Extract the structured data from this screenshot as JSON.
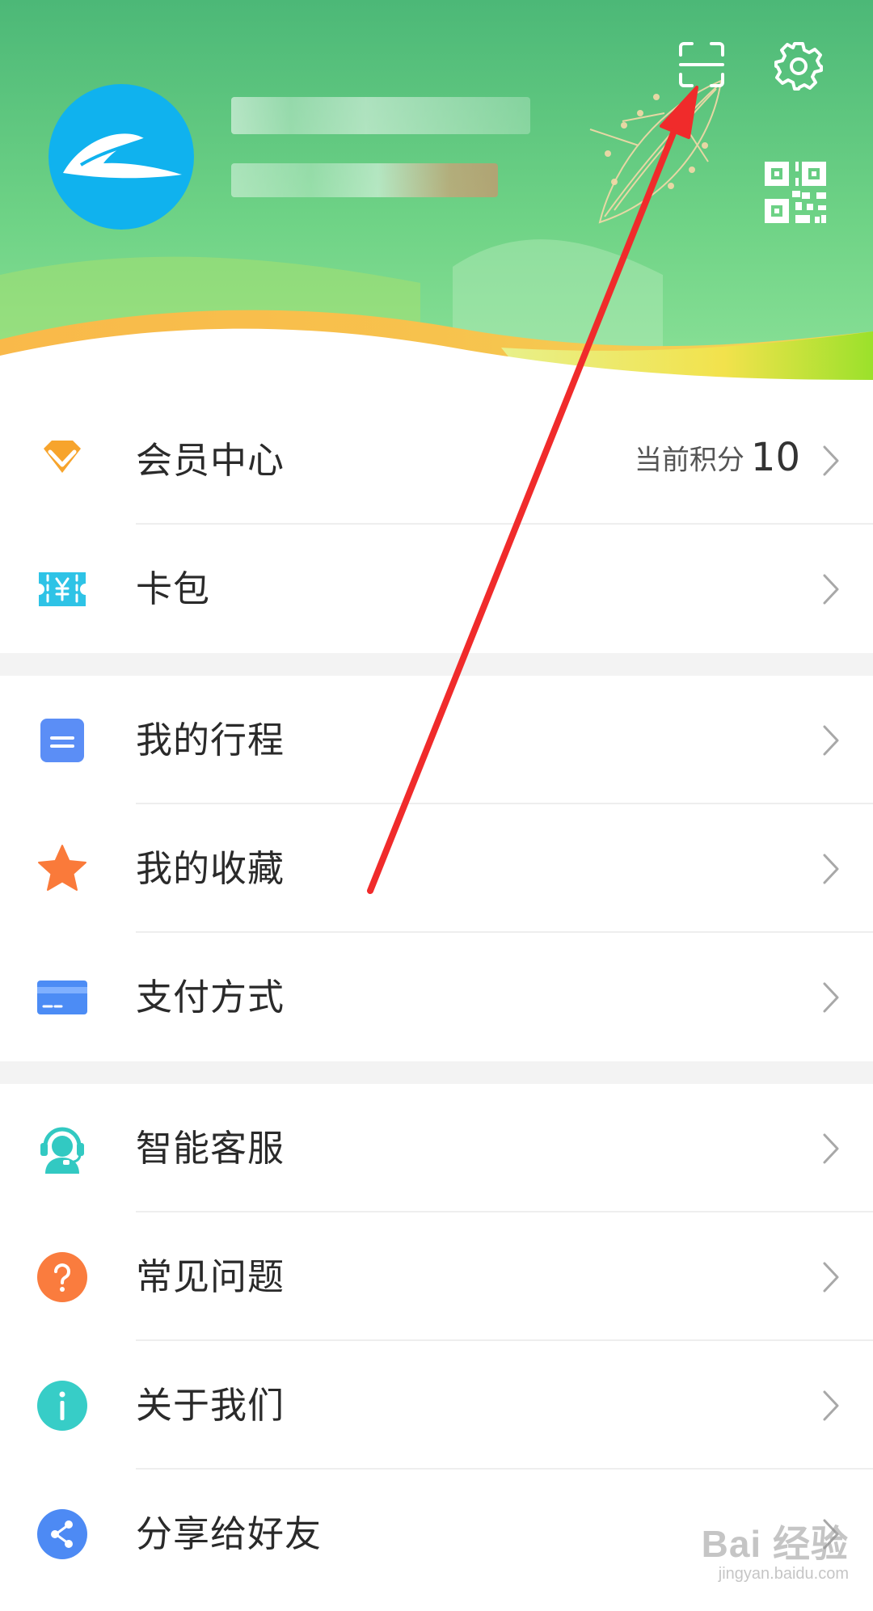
{
  "menu": {
    "member_center": {
      "label": "会员中心",
      "points_label": "当前积分",
      "points_value": "10"
    },
    "wallet": {
      "label": "卡包"
    },
    "my_trips": {
      "label": "我的行程"
    },
    "favorites": {
      "label": "我的收藏"
    },
    "payment": {
      "label": "支付方式"
    },
    "smart_service": {
      "label": "智能客服"
    },
    "faq": {
      "label": "常见问题"
    },
    "about_us": {
      "label": "关于我们"
    },
    "share": {
      "label": "分享给好友"
    }
  },
  "icons": {
    "scan": "scan-icon",
    "settings": "gear-icon",
    "qr_code": "qr-code-icon",
    "member": "diamond-icon",
    "wallet": "ticket-yen-icon",
    "trips": "document-icon",
    "favorites": "star-icon",
    "payment": "card-icon",
    "service": "headset-icon",
    "faq": "question-icon",
    "about": "info-icon",
    "share": "share-icon",
    "chevron": "chevron-right-icon"
  },
  "colors": {
    "header_green": "#5fcf7d",
    "avatar_blue": "#10b2ee",
    "member_orange": "#f7a42c",
    "wallet_cyan": "#2ec3e6",
    "trips_blue": "#5b8ef6",
    "favorites_orange": "#fa7a3a",
    "payment_blue": "#4c8cf5",
    "service_teal": "#32c9c2",
    "faq_orange": "#fa7c3e",
    "about_teal": "#37cdc7",
    "share_blue": "#4d8af4",
    "annotation_red": "#f02b2b"
  },
  "watermark": {
    "main": "Bai 经验",
    "sub": "jingyan.baidu.com"
  }
}
